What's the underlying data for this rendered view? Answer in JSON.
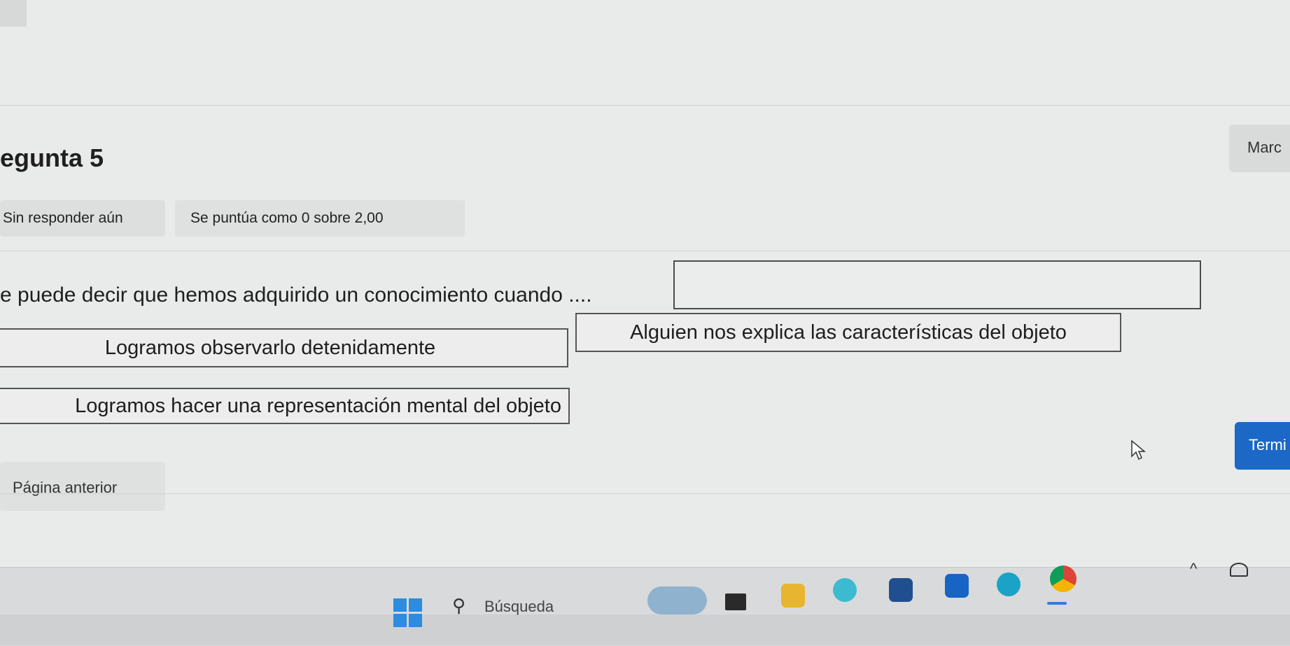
{
  "header": {
    "question_label": "egunta 5",
    "flag_button_label": "Marc"
  },
  "status": {
    "answer_state": "Sin responder aún",
    "score": "Se puntúa como 0 sobre 2,00"
  },
  "question": {
    "text": "e puede decir que hemos adquirido un conocimiento cuando ...."
  },
  "options": [
    "Logramos  observarlo detenidamente",
    "Alguien nos explica las características del objeto",
    "Logramos hacer una representación mental del objeto"
  ],
  "navigation": {
    "previous_label": "Página anterior",
    "finish_label": "Termi"
  },
  "taskbar": {
    "search_placeholder": "Búsqueda",
    "tray_chevron": "^"
  },
  "colors": {
    "accent": "#1b68c6",
    "background": "#e9eaea"
  }
}
